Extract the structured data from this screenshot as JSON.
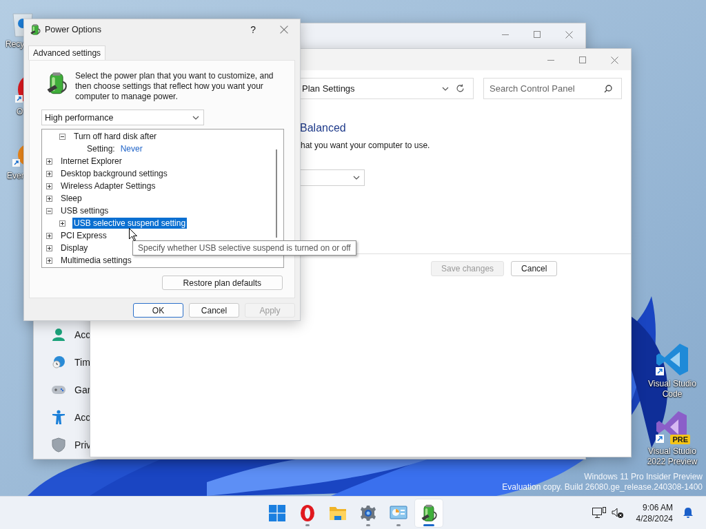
{
  "desktop": {
    "icons": [
      {
        "kind": "recycle-bin",
        "label": "Recy"
      },
      {
        "kind": "opera",
        "label": "O"
      },
      {
        "kind": "evernote",
        "label": "Ever"
      },
      {
        "kind": "vscode",
        "label": "Visual Studio Code"
      },
      {
        "kind": "vs-preview",
        "label": "Visual Studio 2022 Preview",
        "badge": "PRE"
      }
    ],
    "watermark": [
      "Windows 11 Pro Insider Preview",
      "Evaluation copy. Build 26080.ge_release.240308-1400"
    ]
  },
  "settings_window": {
    "nav_items": [
      {
        "kind": "account",
        "label": "Acc"
      },
      {
        "kind": "time",
        "label": "Tim"
      },
      {
        "kind": "gaming",
        "label": "Gar"
      },
      {
        "kind": "accessibility",
        "label": "Acc"
      },
      {
        "kind": "privacy",
        "label": "Priv"
      }
    ]
  },
  "control_panel": {
    "address": "Plan Settings",
    "search": {
      "placeholder": "Search Control Panel"
    },
    "heading": "Balanced",
    "text": "hat you want your computer to use.",
    "buttons": [
      {
        "label": "Save changes",
        "disabled": true
      },
      {
        "label": "Cancel",
        "disabled": false
      }
    ]
  },
  "dialog": {
    "title": "Power Options",
    "help": "?",
    "tabs": [
      {
        "label": "Advanced settings",
        "selected": true
      }
    ],
    "description": "Select the power plan that you want to customize, and then choose settings that reflect how you want your computer to manage power.",
    "plan": "High performance",
    "tree": [
      {
        "kind": "offscreen",
        "children": [
          {
            "kind": "node",
            "label": "Turn off hard disk after",
            "expanded": true,
            "selected": false,
            "children": [
              {
                "kind": "setting",
                "label": "Setting:",
                "value": "Never"
              }
            ]
          }
        ]
      },
      {
        "kind": "node",
        "label": "Internet Explorer",
        "expanded": false,
        "selected": false
      },
      {
        "kind": "node",
        "label": "Desktop background settings",
        "expanded": false,
        "selected": false
      },
      {
        "kind": "node",
        "label": "Wireless Adapter Settings",
        "expanded": false,
        "selected": false
      },
      {
        "kind": "node",
        "label": "Sleep",
        "expanded": false,
        "selected": false
      },
      {
        "kind": "node",
        "label": "USB settings",
        "expanded": true,
        "selected": false,
        "children": [
          {
            "kind": "node",
            "label": "USB selective suspend setting",
            "expanded": false,
            "selected": true
          }
        ]
      },
      {
        "kind": "node",
        "label": "PCI Express",
        "expanded": false,
        "selected": false
      },
      {
        "kind": "node",
        "label": "Display",
        "expanded": false,
        "selected": false
      },
      {
        "kind": "node",
        "label": "Multimedia settings",
        "expanded": false,
        "selected": false
      }
    ],
    "restore_button": "Restore plan defaults",
    "buttons": [
      {
        "label": "OK",
        "default": true,
        "disabled": false
      },
      {
        "label": "Cancel",
        "default": false,
        "disabled": false
      },
      {
        "label": "Apply",
        "default": false,
        "disabled": true
      }
    ]
  },
  "tooltip": "Specify whether USB selective suspend is turned on or off",
  "taskbar": {
    "apps": [
      {
        "kind": "start",
        "running": false,
        "selected": false
      },
      {
        "kind": "opera",
        "running": true,
        "selected": false
      },
      {
        "kind": "explorer",
        "running": false,
        "selected": false
      },
      {
        "kind": "settings",
        "running": true,
        "selected": false
      },
      {
        "kind": "control-panel",
        "running": true,
        "selected": false
      },
      {
        "kind": "power",
        "running": true,
        "selected": true
      }
    ],
    "time": "9:06 AM",
    "date": "4/28/2024"
  }
}
